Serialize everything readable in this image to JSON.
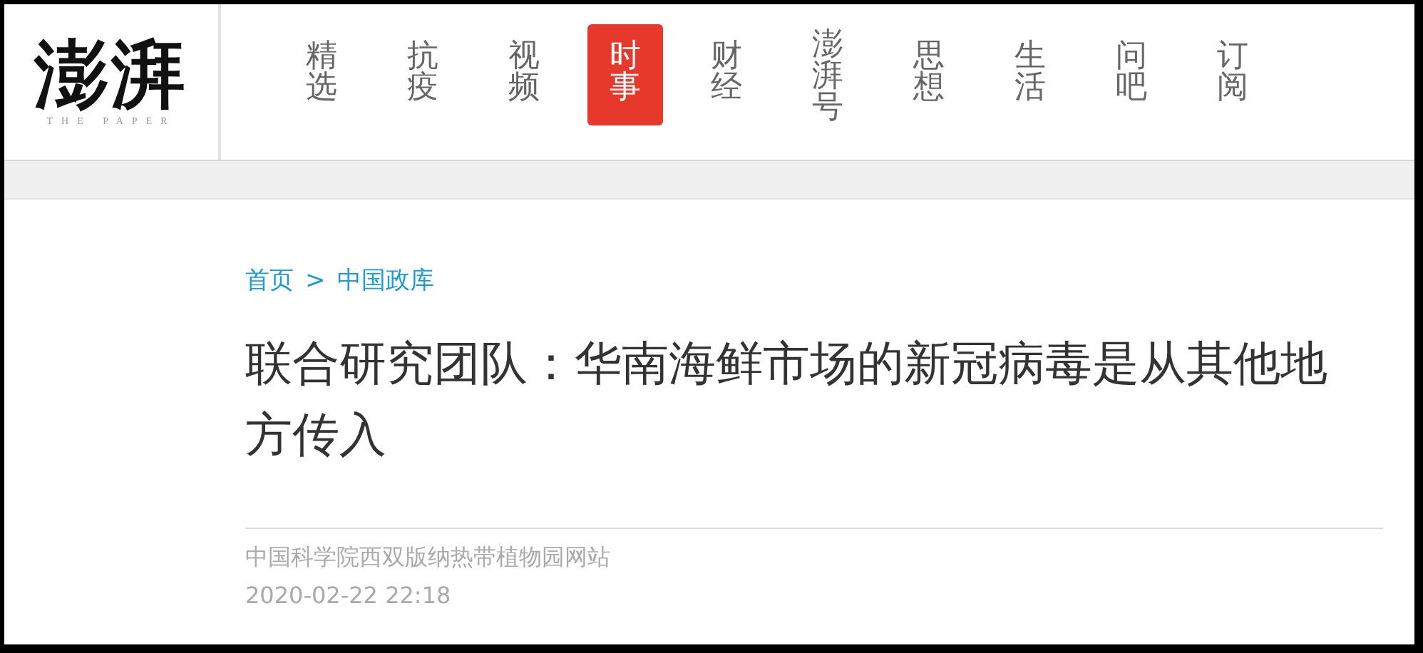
{
  "logo": {
    "title": "澎湃",
    "subtitle": "THE PAPER"
  },
  "nav": [
    {
      "label": "精选",
      "selected": false
    },
    {
      "label": "抗疫",
      "selected": false
    },
    {
      "label": "视频",
      "selected": false
    },
    {
      "label": "时事",
      "selected": true
    },
    {
      "label": "财经",
      "selected": false
    },
    {
      "label": "澎湃号",
      "selected": false
    },
    {
      "label": "思想",
      "selected": false
    },
    {
      "label": "生活",
      "selected": false
    },
    {
      "label": "问吧",
      "selected": false
    },
    {
      "label": "订阅",
      "selected": false
    }
  ],
  "breadcrumb": {
    "items": [
      "首页",
      "中国政库"
    ],
    "separator": ">"
  },
  "article": {
    "title": "联合研究团队：华南海鲜市场的新冠病毒是从其他地方传入",
    "source": "中国科学院西双版纳热带植物园网站",
    "date": "2020-02-22 22:18"
  }
}
